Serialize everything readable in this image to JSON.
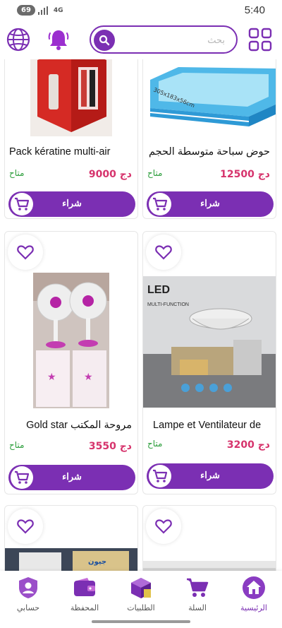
{
  "status_bar": {
    "battery": "69",
    "network": "4G",
    "time": "5:40"
  },
  "header": {
    "search_placeholder": "بحث"
  },
  "products": [
    {
      "title": "Pack  kératine multi-air",
      "price": "9000 دج",
      "availability": "متاح",
      "buy_label": "شراء"
    },
    {
      "title": "حوض سباحة متوسطة الحجم",
      "price": "12500 دج",
      "availability": "متاح",
      "buy_label": "شراء",
      "image_text": "305x183x56cm"
    },
    {
      "title": "مروحة المكتب Gold star",
      "price": "3550 دج",
      "availability": "متاح",
      "buy_label": "شراء"
    },
    {
      "title": "Lampe et Ventilateur de",
      "price": "3200 دج",
      "availability": "متاح",
      "buy_label": "شراء",
      "image_text": "LED",
      "image_subtext": "MULTI-FUNCTION"
    },
    {
      "image_text": "جيون"
    },
    {}
  ],
  "bottom_nav": [
    {
      "label": "حسابي",
      "icon": "account-icon"
    },
    {
      "label": "المحفظة",
      "icon": "wallet-icon"
    },
    {
      "label": "الطلبيات",
      "icon": "orders-icon"
    },
    {
      "label": "السلة",
      "icon": "cart-icon"
    },
    {
      "label": "الرئيسية",
      "icon": "home-icon",
      "active": true
    }
  ],
  "colors": {
    "primary": "#7b2fb3",
    "price": "#d6336c",
    "available": "#2a9d3a"
  }
}
